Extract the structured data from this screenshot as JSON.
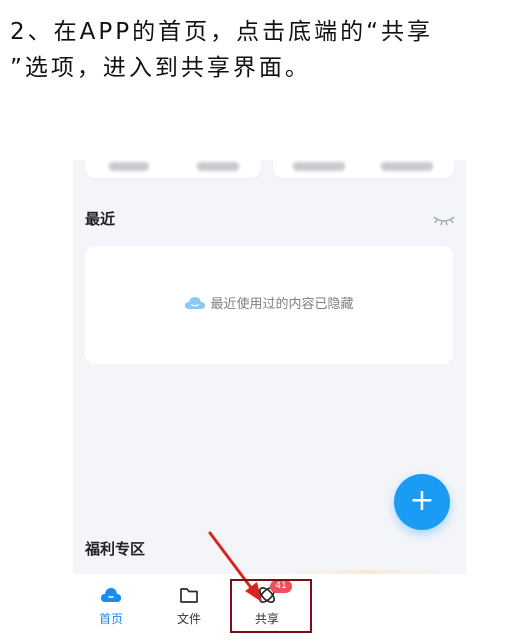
{
  "instruction": {
    "line1": "2、在APP的首页，点击底端的“共享",
    "line2": "”选项，进入到共享界面。"
  },
  "recent": {
    "title": "最近",
    "hidden_message": "最近使用过的内容已隐藏",
    "eye_icon": "eye-closed-icon",
    "cloud_icon": "cloud-icon"
  },
  "fab": {
    "label": "+",
    "color": "#1a9cf5"
  },
  "welfare": {
    "title": "福利专区"
  },
  "tabbar": {
    "items": [
      {
        "label": "首页",
        "icon": "cloud-home-icon",
        "active": true
      },
      {
        "label": "文件",
        "icon": "folder-icon",
        "active": false
      },
      {
        "label": "共享",
        "icon": "share-atom-icon",
        "active": false,
        "badge": "41"
      }
    ]
  },
  "colors": {
    "accent": "#1a8cf0",
    "badge": "#f04e5b",
    "highlight": "#7a1012",
    "arrow": "#d6261f"
  }
}
